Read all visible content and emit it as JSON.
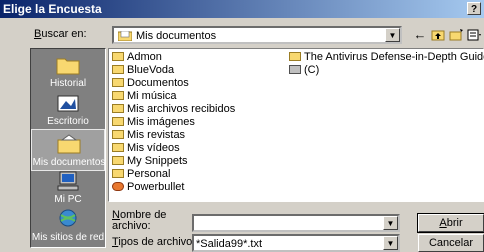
{
  "window": {
    "title": "Elige la Encuesta",
    "help_label": "?"
  },
  "lookin": {
    "label_u": "B",
    "label_rest": "uscar en:",
    "value": "Mis documentos"
  },
  "places": [
    {
      "label": "Historial",
      "icon": "folder-icon",
      "selected": false
    },
    {
      "label": "Escritorio",
      "icon": "desktop-icon",
      "selected": false
    },
    {
      "label": "Mis documentos",
      "icon": "documents-folder-icon",
      "selected": true
    },
    {
      "label": "Mi PC",
      "icon": "computer-icon",
      "selected": false
    },
    {
      "label": "Mis sitios de red",
      "icon": "network-icon",
      "selected": false
    }
  ],
  "files_col1": [
    {
      "name": "Admon",
      "icon": "folder-icon"
    },
    {
      "name": "BlueVoda",
      "icon": "folder-icon"
    },
    {
      "name": "Documentos",
      "icon": "folder-icon"
    },
    {
      "name": "Mi música",
      "icon": "folder-icon"
    },
    {
      "name": "Mis archivos recibidos",
      "icon": "folder-icon"
    },
    {
      "name": "Mis imágenes",
      "icon": "folder-icon"
    },
    {
      "name": "Mis revistas",
      "icon": "folder-icon"
    },
    {
      "name": "Mis vídeos",
      "icon": "folder-icon"
    },
    {
      "name": "My Snippets",
      "icon": "folder-icon"
    },
    {
      "name": "Personal",
      "icon": "folder-icon"
    },
    {
      "name": "Powerbullet",
      "icon": "app-icon"
    }
  ],
  "files_col2": [
    {
      "name": "The Antivirus Defense-in-Depth Guide",
      "icon": "folder-icon"
    },
    {
      "name": "(C)",
      "icon": "drive-icon"
    }
  ],
  "filename": {
    "label_u": "N",
    "label_rest": "ombre de",
    "label_line2": "archivo:",
    "value": ""
  },
  "filetype": {
    "label_u": "T",
    "label_rest": "ipos de archivo:",
    "value": "*Salida99*.txt"
  },
  "buttons": {
    "open_u": "A",
    "open_rest": "brir",
    "cancel": "Cancelar"
  },
  "toolbar": {
    "back": "←",
    "up_folder": "up-folder-icon",
    "new_folder": "new-folder-icon",
    "views": "views-icon"
  }
}
